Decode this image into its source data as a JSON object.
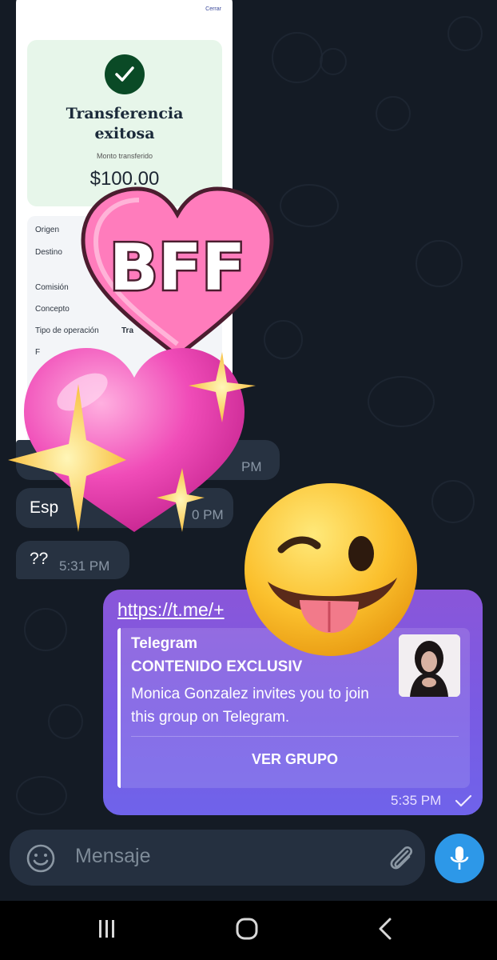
{
  "receipt": {
    "close_label": "Cerrar",
    "title": "Transferencia exitosa",
    "amount_label": "Monto transferido",
    "amount": "$100.00",
    "details": [
      {
        "label": "Origen",
        "value": ""
      },
      {
        "label": "Destino",
        "value": ""
      },
      {
        "label": "Comisión",
        "value": ""
      },
      {
        "label": "Concepto",
        "value": ""
      },
      {
        "label": "Tipo de operación",
        "value": "Tra"
      },
      {
        "label": "F",
        "value": ""
      }
    ]
  },
  "incoming_messages": [
    {
      "text": "",
      "time": "PM"
    },
    {
      "text": "Esp",
      "time": "0 PM"
    },
    {
      "text": "??",
      "time": "5:31 PM"
    }
  ],
  "outgoing_message": {
    "link": "https://t.me/+",
    "preview_site": "Telegram",
    "preview_title": "CONTENIDO EXCLUSIV",
    "preview_description": "Monica Gonzalez invites you to join this group on Telegram.",
    "preview_button": "VER GRUPO",
    "time": "5:35 PM",
    "status_icon": "check-icon"
  },
  "stickers": [
    {
      "name": "bff-heart-sticker",
      "text": "BFF"
    },
    {
      "name": "sparkling-heart-sticker"
    },
    {
      "name": "winking-tongue-face-sticker"
    }
  ],
  "composer": {
    "placeholder": "Mensaje",
    "emoji_icon": "emoji-icon",
    "attach_icon": "paperclip-icon",
    "mic_icon": "microphone-icon"
  },
  "colors": {
    "background": "#141b25",
    "outgoing_gradient_top": "#8a56d9",
    "outgoing_gradient_bottom": "#6f63ea",
    "mic_button": "#2d98e8",
    "success_green": "#0a4a26"
  },
  "navigation": [
    "recent-apps-icon",
    "home-icon",
    "back-icon"
  ]
}
